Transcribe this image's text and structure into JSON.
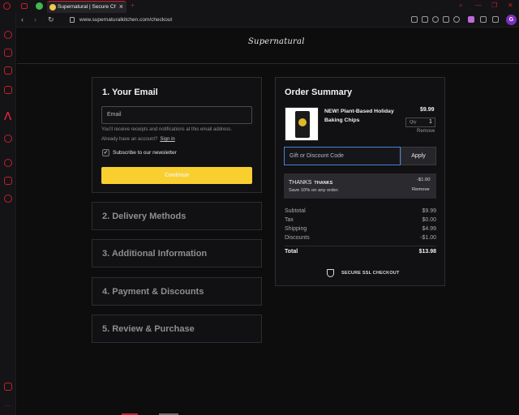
{
  "browser": {
    "tab_title": "Supernatural | Secure Checkout",
    "url": "www.supernaturalkitchen.com/checkout",
    "avatar_letter": "G",
    "accent": "#d21f33"
  },
  "site": {
    "logo_text": "Supernatural"
  },
  "email_step": {
    "title": "1.  Your Email",
    "placeholder": "Email",
    "help": "You'll receive receipts and notifications at this email address.",
    "account_question": "Already have an account?",
    "signin": "Sign in",
    "newsletter": "Subscribe to our newsletter",
    "newsletter_checked": true,
    "continue": "Continue",
    "continue_color": "#f8cf2f"
  },
  "steps": [
    {
      "title": "2.  Delivery Methods"
    },
    {
      "title": "3.  Additional Information"
    },
    {
      "title": "4.  Payment & Discounts"
    },
    {
      "title": "5.  Review & Purchase"
    }
  ],
  "summary": {
    "title": "Order Summary",
    "item": {
      "name": "NEW! Plant-Based Holiday Baking Chips",
      "price": "$9.99",
      "qty_label": "Qty",
      "qty": "1",
      "remove": "Remove"
    },
    "discount_placeholder": "Gift or Discount Code",
    "apply": "Apply",
    "coupon": {
      "code": "THANKS",
      "code_tag": "THANKS",
      "desc": "Save 10% on any order.",
      "amount": "-$1.00",
      "remove": "Remove"
    },
    "rows": [
      {
        "label": "Subtotal",
        "value": "$9.99"
      },
      {
        "label": "Tax",
        "value": "$0.00"
      },
      {
        "label": "Shipping",
        "value": "$4.99"
      },
      {
        "label": "Discounts",
        "value": "-$1.00"
      }
    ],
    "total": {
      "label": "Total",
      "value": "$13.98"
    },
    "ssl": "SECURE SSL CHECKOUT"
  }
}
